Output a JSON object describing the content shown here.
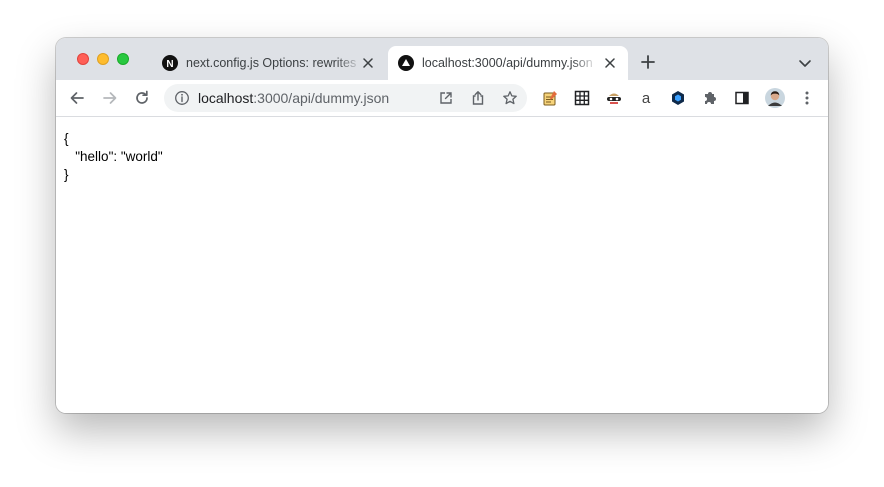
{
  "browser": {
    "tabs": [
      {
        "title": "next.config.js Options: rewrites",
        "favicon": "nextjs-logo-icon",
        "active": false
      },
      {
        "title": "localhost:3000/api/dummy.json",
        "favicon": "vercel-triangle-icon",
        "active": true
      }
    ],
    "address_bar": {
      "host": "localhost",
      "path": ":3000/api/dummy.json"
    },
    "extensions": [
      "notes-extension-icon",
      "grid-extension-icon",
      "spy-extension-icon",
      "amazon-extension-icon",
      "hexagon-extension-icon",
      "puzzle-icon",
      "sidepanel-icon",
      "profile-avatar",
      "kebab-menu-icon"
    ]
  },
  "page": {
    "json_lines": [
      "{",
      "   \"hello\": \"world\"",
      "}"
    ]
  },
  "colors": {
    "tabstrip": "#dee1e6",
    "omnibox": "#f1f3f4",
    "close_red": "#ff5f57",
    "minimize_yellow": "#febc2e",
    "zoom_green": "#28c840"
  }
}
